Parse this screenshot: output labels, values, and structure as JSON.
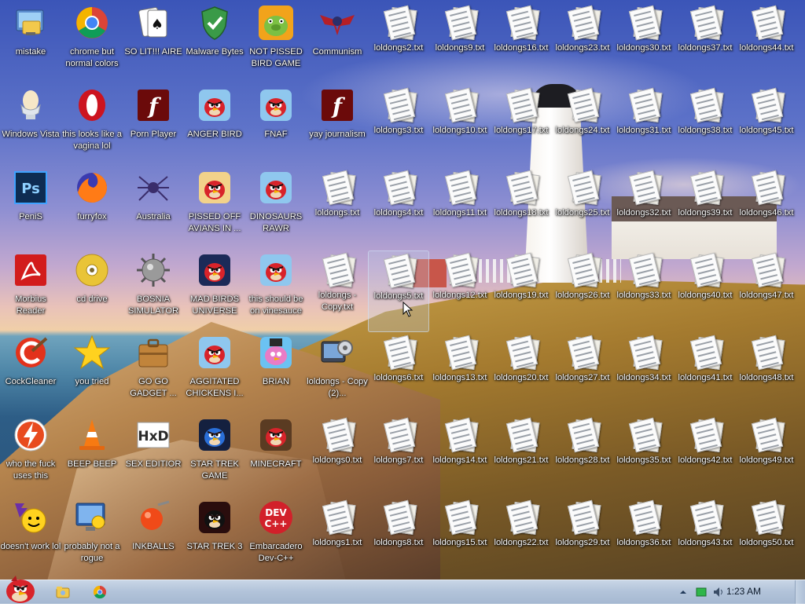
{
  "desktop": {
    "icons": [
      {
        "label": "mistake",
        "icon": "computer-folder-icon"
      },
      {
        "label": "chrome but normal colors",
        "icon": "chrome-icon"
      },
      {
        "label": "SO LIT!!! AIRE",
        "icon": "solitaire-cards-icon"
      },
      {
        "label": "Malware Bytes",
        "icon": "shield-check-icon"
      },
      {
        "label": "NOT PISSED BIRD GAME",
        "icon": "green-pig-icon"
      },
      {
        "label": "Communism",
        "icon": "winged-emblem-icon"
      },
      {
        "label": "Windows Vista",
        "icon": "egg-cup-icon"
      },
      {
        "label": "this looks like a vagina lol",
        "icon": "opera-icon"
      },
      {
        "label": "Porn Player",
        "icon": "flash-player-icon"
      },
      {
        "label": "ANGER BIRD",
        "icon": "angry-bird-icon"
      },
      {
        "label": "FNAF",
        "icon": "angry-bird-icon"
      },
      {
        "label": "yay journalism",
        "icon": "flash-player-icon"
      },
      {
        "label": "PeniS",
        "icon": "photoshop-icon"
      },
      {
        "label": "furryfox",
        "icon": "firefox-icon"
      },
      {
        "label": "Australia",
        "icon": "spider-solitaire-icon"
      },
      {
        "label": "PISSED OFF AVIANS IN ...",
        "icon": "angry-birds-seasons-icon"
      },
      {
        "label": "DINOSAURS RAWR",
        "icon": "angry-bird-icon"
      },
      {
        "label": "Morbius Reader",
        "icon": "acrobat-reader-icon"
      },
      {
        "label": "cd drive",
        "icon": "cd-disc-icon"
      },
      {
        "label": "BOSNIA SIMULATOR",
        "icon": "spiked-mine-icon"
      },
      {
        "label": "MAD BIRDS UNIVERSE",
        "icon": "angry-birds-space-icon"
      },
      {
        "label": "this should be on vinesauce",
        "icon": "angry-bird-icon"
      },
      {
        "label": "CockCleaner",
        "icon": "ccleaner-icon"
      },
      {
        "label": "you tried",
        "icon": "gold-star-icon"
      },
      {
        "label": "GO GO GADGET ...",
        "icon": "briefcase-icon"
      },
      {
        "label": "AGGITATED CHICKENS I...",
        "icon": "angry-bird-icon"
      },
      {
        "label": "BRIAN",
        "icon": "brian-bird-icon"
      },
      {
        "label": "loldongs - Copy (2)...",
        "icon": "settings-gear-icon"
      },
      {
        "label": "who the fuck uses this",
        "icon": "lightning-bolt-icon"
      },
      {
        "label": "BEEP BEEP",
        "icon": "traffic-cone-icon"
      },
      {
        "label": "SEX EDITIOR",
        "icon": "hxd-editor-icon"
      },
      {
        "label": "STAR TREK GAME",
        "icon": "star-trek-bird-icon"
      },
      {
        "label": "MINECRAFT",
        "icon": "minecraft-bird-icon"
      },
      {
        "label": "doesn't work lol",
        "icon": "yahoo-messenger-icon"
      },
      {
        "label": "probably not a rogue",
        "icon": "monitor-gears-icon"
      },
      {
        "label": "INKBALLS",
        "icon": "inkball-icon"
      },
      {
        "label": "STAR TREK 3",
        "icon": "star-wars-bird-icon"
      },
      {
        "label": "Embarcadero Dev-C++",
        "icon": "dev-cpp-icon"
      },
      {
        "label": "loldongs.txt"
      },
      {
        "label": "loldongs - Copy.txt"
      },
      {
        "label": "loldongs0.txt"
      },
      {
        "label": "loldongs1.txt"
      }
    ],
    "txt_columns": [
      [
        "loldongs2.txt",
        "loldongs3.txt",
        "loldongs4.txt",
        "loldongs5.txt",
        "loldongs6.txt",
        "loldongs7.txt",
        "loldongs8.txt"
      ],
      [
        "loldongs9.txt",
        "loldongs10.txt",
        "loldongs11.txt",
        "loldongs12.txt",
        "loldongs13.txt",
        "loldongs14.txt",
        "loldongs15.txt"
      ],
      [
        "loldongs16.txt",
        "loldongs17.txt",
        "loldongs18.txt",
        "loldongs19.txt",
        "loldongs20.txt",
        "loldongs21.txt",
        "loldongs22.txt"
      ],
      [
        "loldongs23.txt",
        "loldongs24.txt",
        "loldongs25.txt",
        "loldongs26.txt",
        "loldongs27.txt",
        "loldongs28.txt",
        "loldongs29.txt"
      ],
      [
        "loldongs30.txt",
        "loldongs31.txt",
        "loldongs32.txt",
        "loldongs33.txt",
        "loldongs34.txt",
        "loldongs35.txt",
        "loldongs36.txt"
      ],
      [
        "loldongs37.txt",
        "loldongs38.txt",
        "loldongs39.txt",
        "loldongs40.txt",
        "loldongs41.txt",
        "loldongs42.txt",
        "loldongs43.txt"
      ],
      [
        "loldongs44.txt",
        "loldongs45.txt",
        "loldongs46.txt",
        "loldongs47.txt",
        "loldongs48.txt",
        "loldongs49.txt",
        "loldongs50.txt"
      ]
    ],
    "selected_label": "loldongs5.txt"
  },
  "taskbar": {
    "start_icon": "angry-bird-start-icon",
    "pinned": [
      {
        "name": "explorer-folder-icon"
      },
      {
        "name": "chrome-icon"
      }
    ],
    "tray_icons": [
      "show-hidden-icons-arrow",
      "network-icon",
      "volume-icon"
    ],
    "clock": "1:23 AM"
  },
  "colors": {
    "taskbar": "#b3c4da",
    "label_text": "#ffffff",
    "selection": "#bed2eb"
  }
}
